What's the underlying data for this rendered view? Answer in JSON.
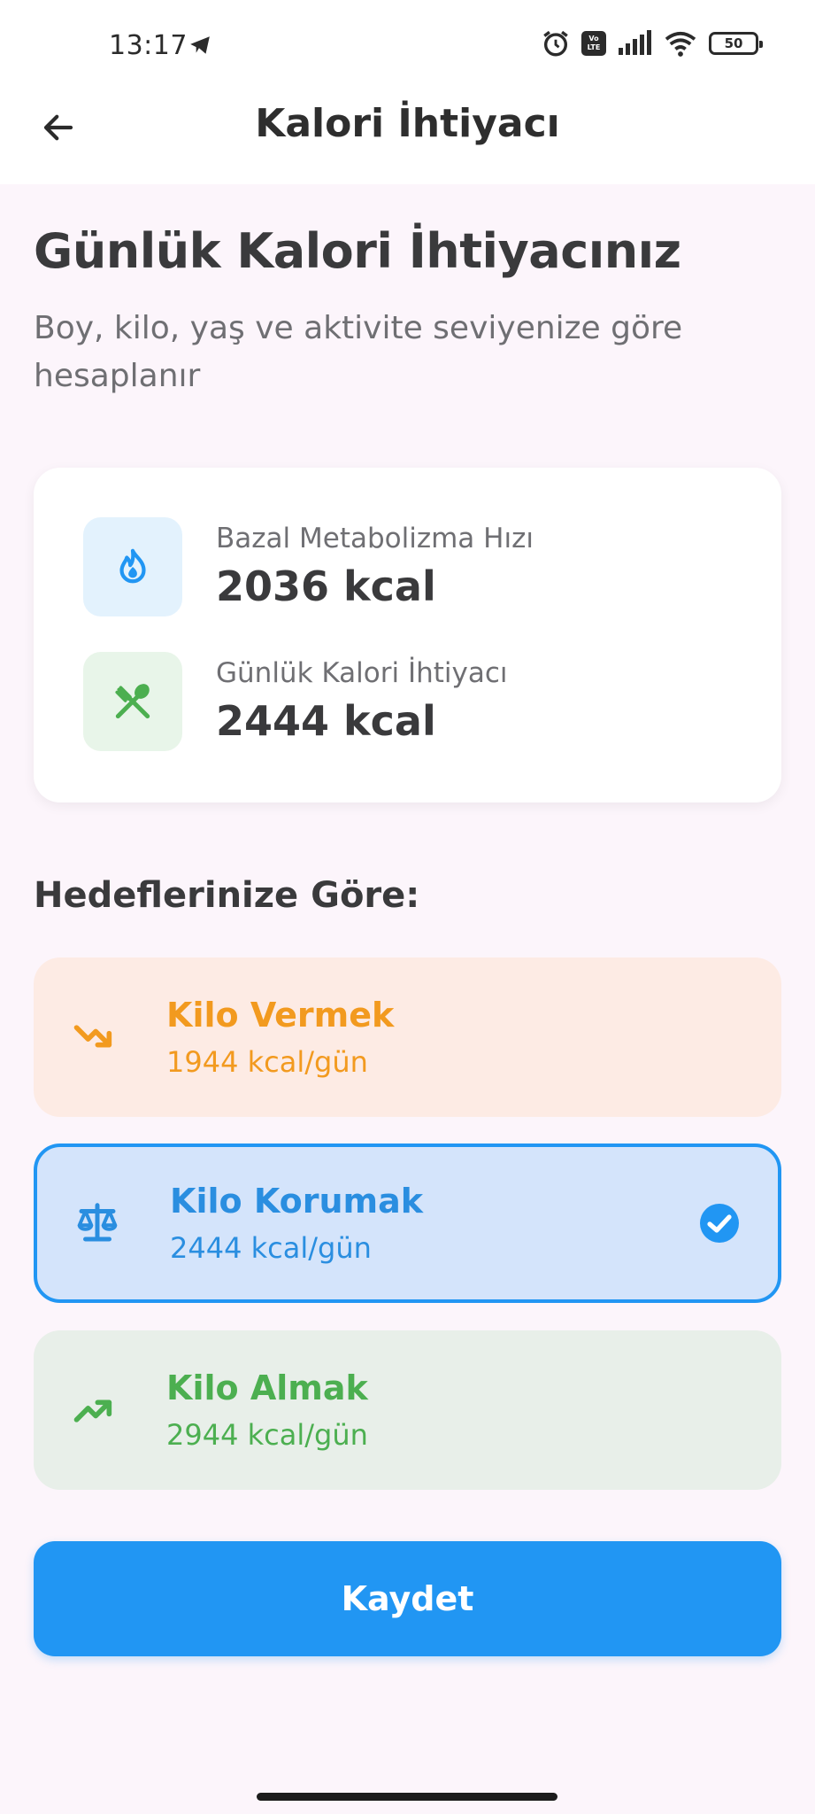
{
  "status_bar": {
    "time": "13:17",
    "battery": "50"
  },
  "app_bar": {
    "title": "Kalori İhtiyacı"
  },
  "header": {
    "title": "Günlük Kalori İhtiyacınız",
    "subtitle": "Boy, kilo, yaş ve aktivite seviyenize göre hesaplanır"
  },
  "summary": {
    "bmr": {
      "label": "Bazal Metabolizma Hızı",
      "value": "2036 kcal",
      "icon": "flame-icon"
    },
    "daily": {
      "label": "Günlük Kalori İhtiyacı",
      "value": "2444 kcal",
      "icon": "fork-spoon-icon"
    }
  },
  "goals": {
    "section_title": "Hedeflerinize Göre:",
    "selected": "keep",
    "items": [
      {
        "id": "lose",
        "title": "Kilo Vermek",
        "subtitle": "1944 kcal/gün",
        "icon": "trending-down-icon",
        "color": "#f29a1f"
      },
      {
        "id": "keep",
        "title": "Kilo Korumak",
        "subtitle": "2444 kcal/gün",
        "icon": "balance-scale-icon",
        "color": "#2196f3"
      },
      {
        "id": "gain",
        "title": "Kilo Almak",
        "subtitle": "2944 kcal/gün",
        "icon": "trending-up-icon",
        "color": "#4caf50"
      }
    ]
  },
  "actions": {
    "save_label": "Kaydet"
  },
  "colors": {
    "primary": "#2196f3",
    "background": "#fcf5fb"
  }
}
